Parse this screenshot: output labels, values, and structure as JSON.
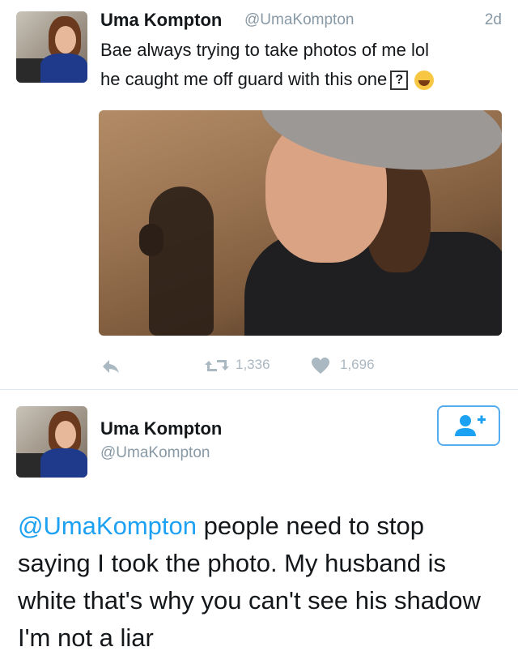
{
  "tweet1": {
    "name": "Uma Kompton",
    "handle": "@UmaKompton",
    "time": "2d",
    "text_line1": "Bae always trying to take photos of me lol",
    "text_line2": "he caught me off guard with this one",
    "unknown_glyph": "?",
    "retweets": "1,336",
    "likes": "1,696"
  },
  "tweet2": {
    "name": "Uma Kompton",
    "handle": "@UmaKompton",
    "mention": "@UmaKompton",
    "text": " people need to stop saying I took the photo. My husband is white that's why you can't see his shadow I'm not a liar"
  },
  "colors": {
    "link": "#1da1f2",
    "muted": "#8899a6",
    "icon": "#aab8c2",
    "follow_border": "#55acee"
  },
  "icons": [
    "reply-icon",
    "retweet-icon",
    "heart-icon",
    "follow-user-icon",
    "laughing-emoji-icon"
  ]
}
